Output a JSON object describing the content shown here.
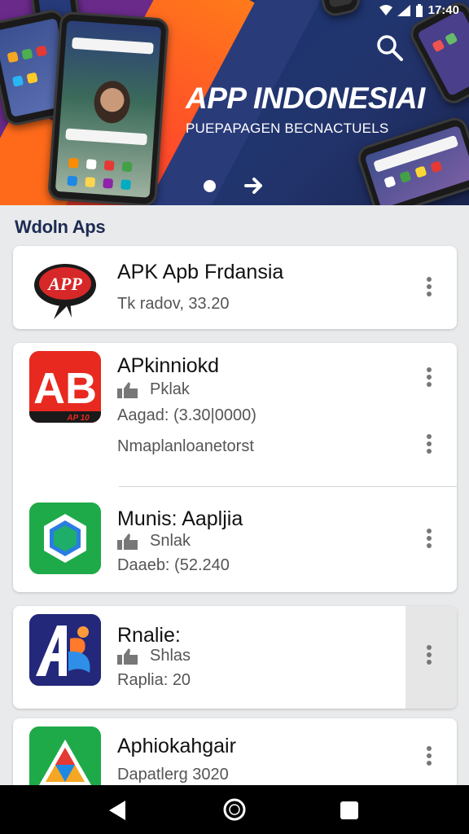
{
  "status_bar": {
    "time": "17:40"
  },
  "banner": {
    "title": "APP INDONESIAI",
    "subtitle": "PUEPAPAGEN BECNACTUELS"
  },
  "section": {
    "title": "Wdoln Aps"
  },
  "apps": [
    {
      "name": "APK Apb Frdansia",
      "line1": "Tk radov, 33.20",
      "icon": "red-warrior-logo-icon"
    },
    {
      "name": "APkinniokd",
      "rating_label": "Pklak",
      "line2": "Aagad: (3.30|0000)",
      "line3": "Nmaplanloanetorst",
      "icon": "ab-red-app-icon"
    },
    {
      "name": "Munis: Aapljia",
      "rating_label": "Snlak",
      "line2": "Daaeb: (52.240",
      "icon": "green-hexagon-app-icon"
    },
    {
      "name": "Rnalie:",
      "rating_label": "Shlas",
      "line2": "Raplia: 20",
      "icon": "af-blue-app-icon"
    },
    {
      "name": "Aphiokahgair",
      "line2": "Dapatlerg 3020",
      "icon": "triangle-colorful-app-icon"
    }
  ],
  "colors": {
    "banner_bg": "#1e3570",
    "accent_orange": "#ff6a1a",
    "section_title": "#1d2b52"
  }
}
